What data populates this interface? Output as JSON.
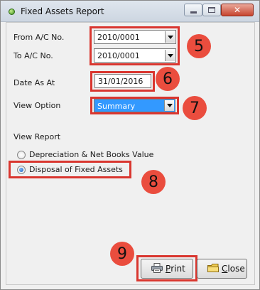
{
  "window": {
    "title": "Fixed Assets Report",
    "icons": {
      "app": "green-dot-icon",
      "min": "minimize-icon",
      "max": "maximize-icon",
      "close": "close-icon"
    }
  },
  "form": {
    "from_label": "From A/C No.",
    "from_value": "2010/0001",
    "to_label": "To A/C No.",
    "to_value": "2010/0001",
    "date_label": "Date As At",
    "date_value": "31/01/2016",
    "view_option_label": "View Option",
    "view_option_value": "Summary",
    "view_report_label": "View Report",
    "radio_depreciation": "Depreciation & Net Books Value",
    "radio_disposal": "Disposal of Fixed Assets",
    "selected_report": "Disposal of Fixed Assets"
  },
  "buttons": {
    "print_first": "P",
    "print_rest": "rint",
    "close_first": "C",
    "close_rest": "lose"
  },
  "annotations": {
    "n5": "5",
    "n6": "6",
    "n7": "7",
    "n8": "8",
    "n9": "9"
  },
  "colors": {
    "annotation_red": "#d9362f",
    "badge_fill": "#ea4d3e",
    "selection_blue": "#3399ff"
  }
}
